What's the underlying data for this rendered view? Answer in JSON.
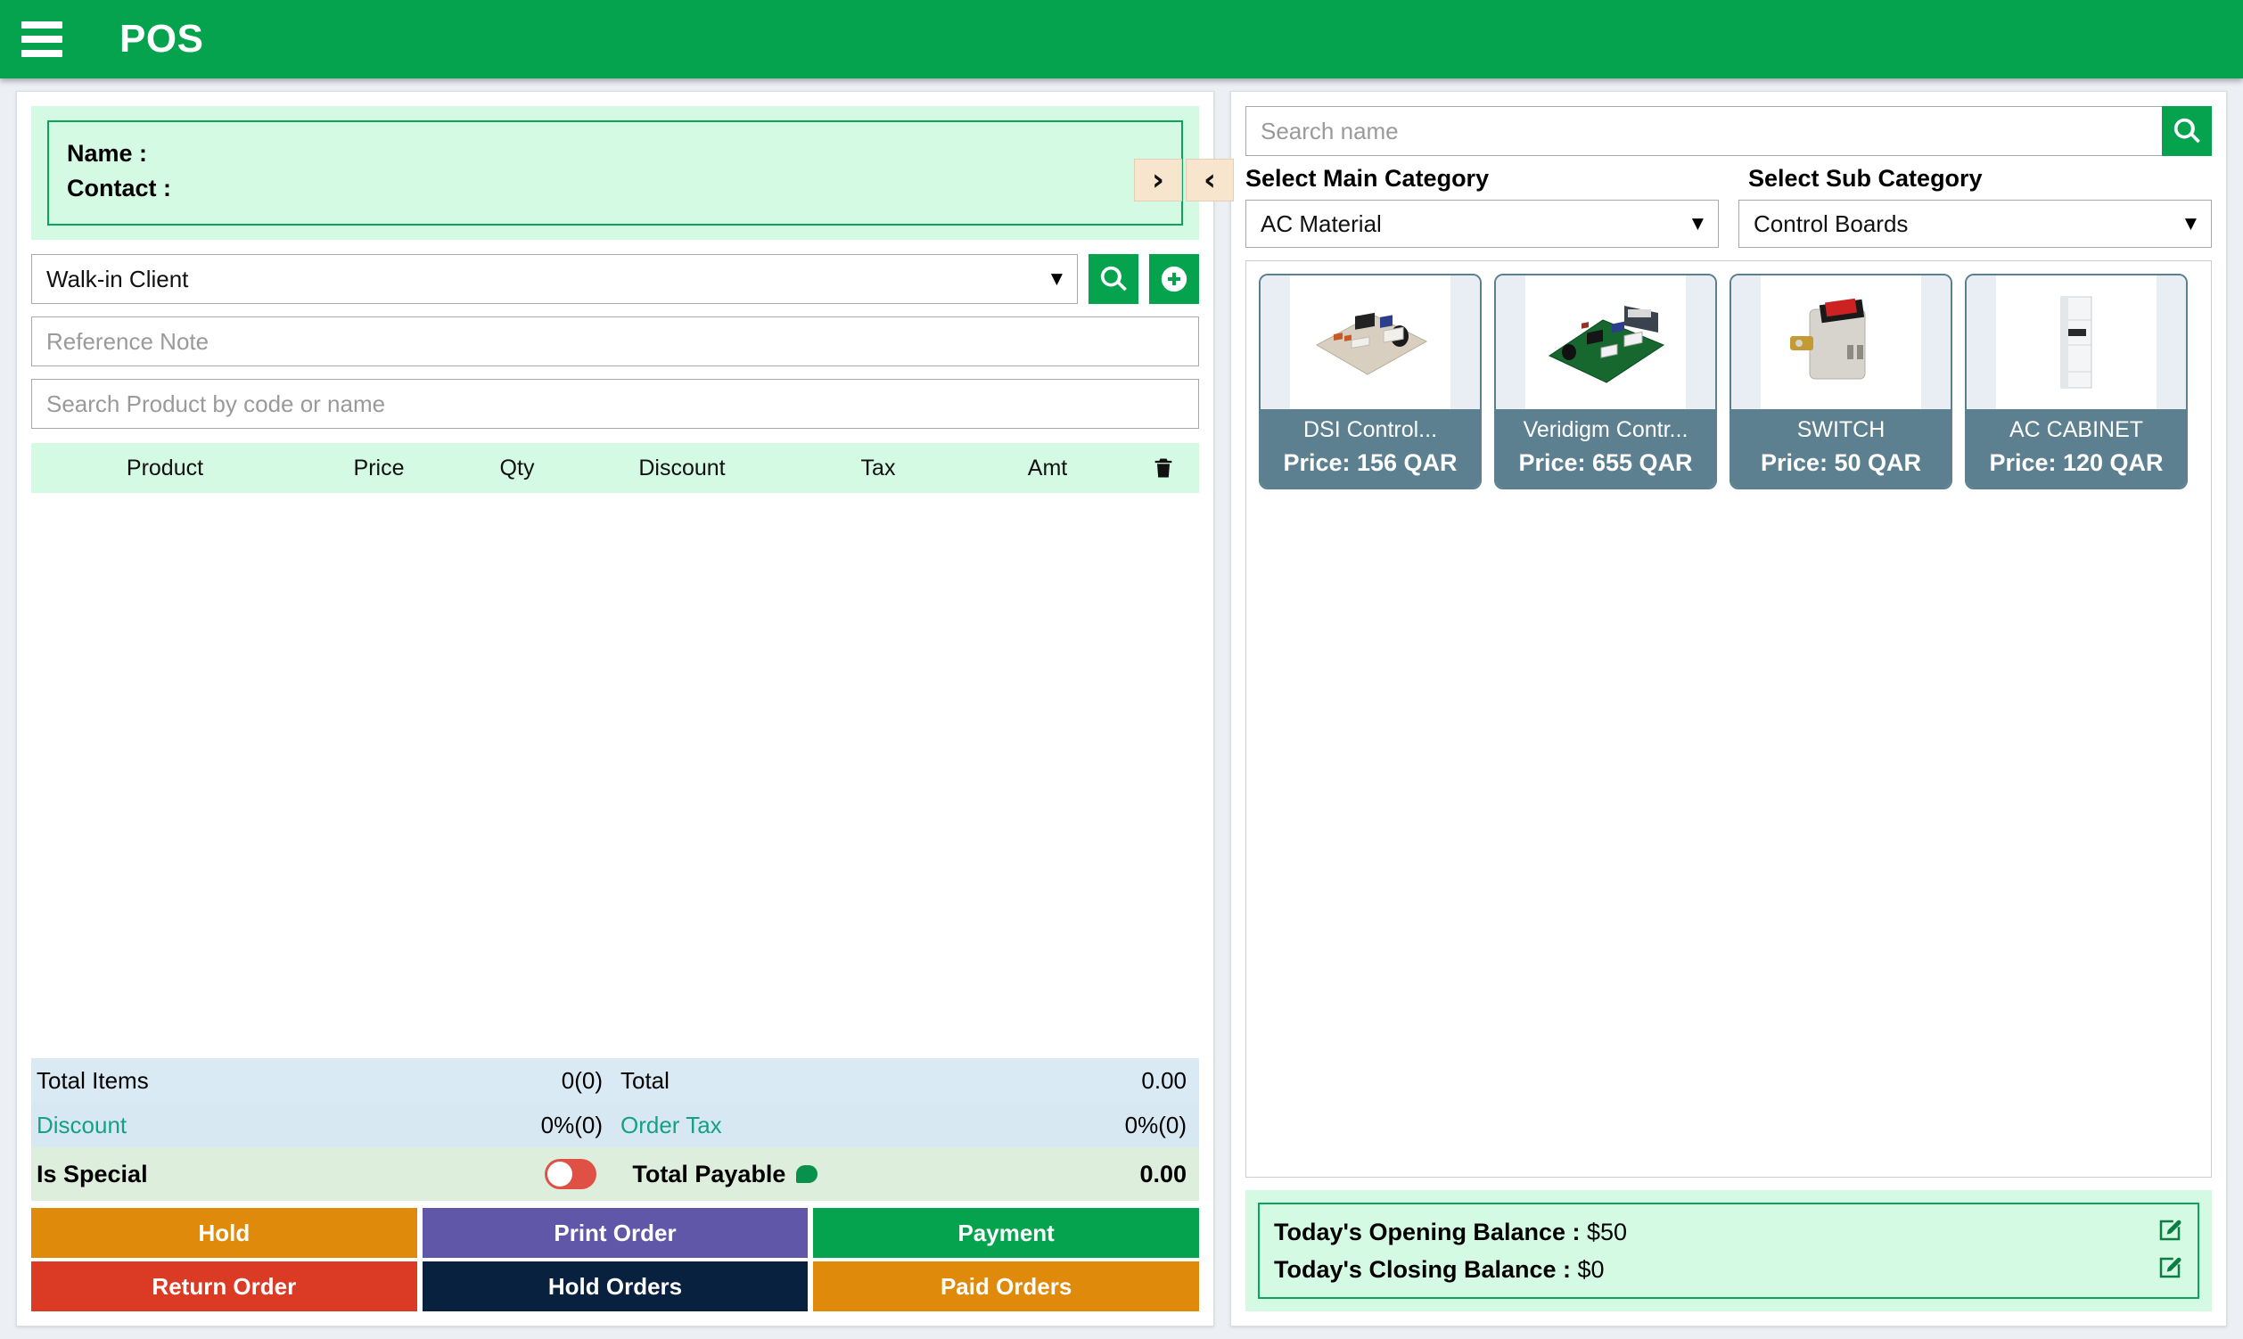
{
  "header": {
    "title": "POS",
    "menu_icon": "hamburger-icon",
    "bg": "#06a34f"
  },
  "panel_toggle": {
    "expand_label": "›",
    "collapse_label": "‹"
  },
  "customer": {
    "name_label": "Name :",
    "contact_label": "Contact :",
    "client_select_value": "Walk-in Client",
    "search_client_icon": "search-icon",
    "add_client_icon": "plus-circle-icon",
    "reference_placeholder": "Reference Note",
    "product_search_placeholder": "Search Product by code or name"
  },
  "cart": {
    "columns": [
      "Product",
      "Price",
      "Qty",
      "Discount",
      "Tax",
      "Amt"
    ],
    "delete_icon": "trash-icon",
    "rows": []
  },
  "totals": {
    "total_items_label": "Total Items",
    "total_items_value": "0(0)",
    "total_label": "Total",
    "total_value": "0.00",
    "discount_label": "Discount",
    "discount_value": "0%(0)",
    "order_tax_label": "Order Tax",
    "order_tax_value": "0%(0)",
    "is_special_label": "Is Special",
    "is_special_on": false,
    "total_payable_label": "Total Payable",
    "total_payable_value": "0.00"
  },
  "actions": [
    {
      "label": "Hold",
      "color": "#e08a0b"
    },
    {
      "label": "Print Order",
      "color": "#6057a8"
    },
    {
      "label": "Payment",
      "color": "#06a34f"
    },
    {
      "label": "Return Order",
      "color": "#db3b25"
    },
    {
      "label": "Hold Orders",
      "color": "#08213f"
    },
    {
      "label": "Paid Orders",
      "color": "#e08a0b"
    }
  ],
  "catalog": {
    "search_placeholder": "Search name",
    "search_icon": "search-icon",
    "main_category_label": "Select Main Category",
    "main_category_value": "AC Material",
    "sub_category_label": "Select Sub Category",
    "sub_category_value": "Control Boards",
    "products": [
      {
        "name": "DSI Control...",
        "price": "Price: 156 QAR",
        "art": "board-beige"
      },
      {
        "name": "Veridigm Contr...",
        "price": "Price: 655 QAR",
        "art": "board-green"
      },
      {
        "name": "SWITCH",
        "price": "Price: 50 QAR",
        "art": "switch"
      },
      {
        "name": "AC CABINET",
        "price": "Price: 120 QAR",
        "art": "cabinet"
      }
    ]
  },
  "balance": {
    "opening_label": "Today's Opening Balance :",
    "opening_value": "$50",
    "closing_label": "Today's Closing Balance :",
    "closing_value": "$0",
    "edit_icon": "edit-pencil-icon"
  }
}
